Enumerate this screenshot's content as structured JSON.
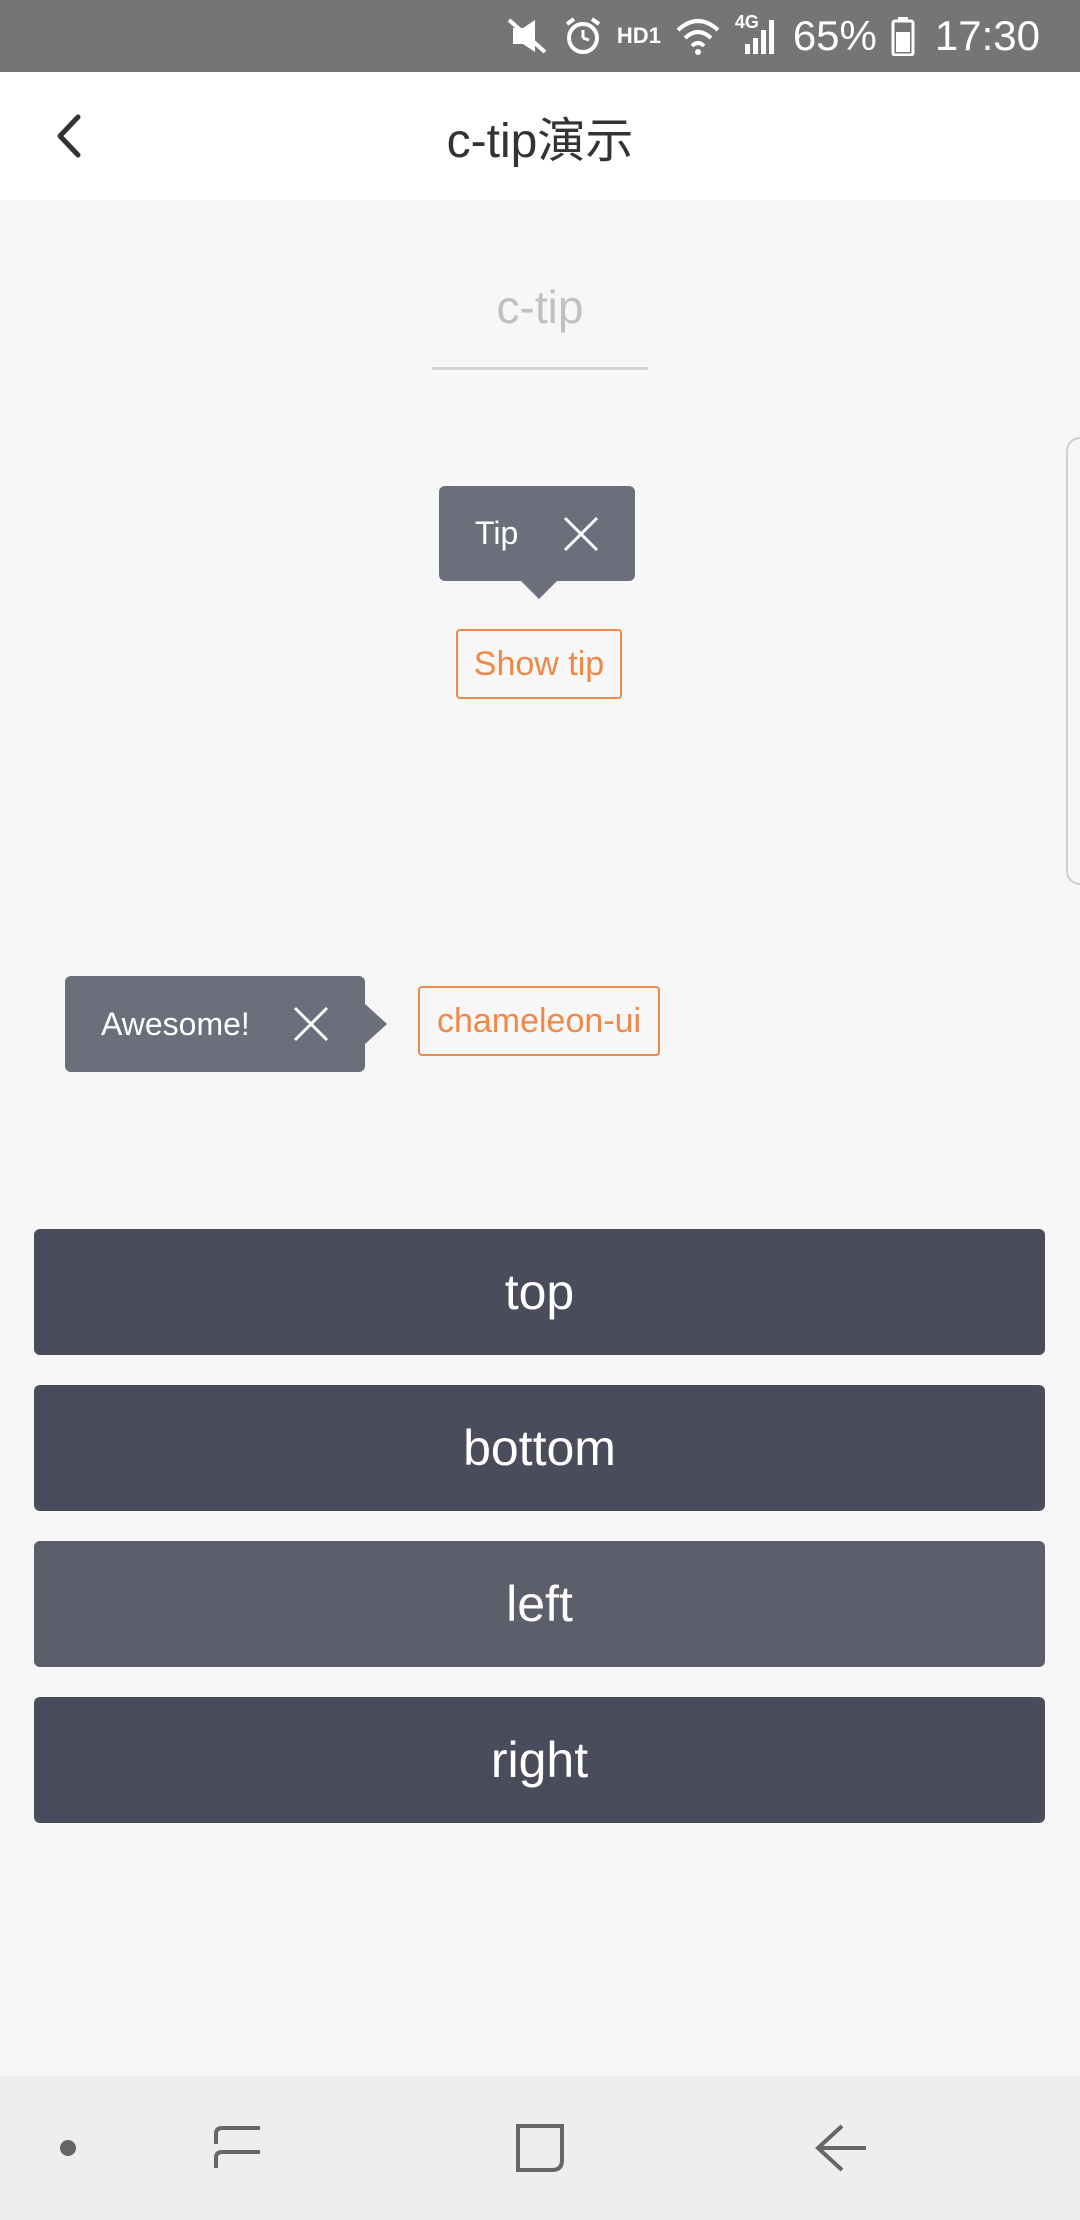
{
  "status_bar": {
    "icons": [
      "mute-vibrate-icon",
      "alarm-icon",
      "hd-icon",
      "wifi-icon",
      "signal-4g-icon",
      "battery-icon"
    ],
    "hd_label": "HD1",
    "network_label": "4G",
    "battery_percent": "65%",
    "time": "17:30"
  },
  "header": {
    "back_icon": "chevron-left-icon",
    "title": "c-tip演示"
  },
  "main": {
    "heading": "c-tip",
    "tip_top": {
      "text": "Tip",
      "close_icon": "close-icon"
    },
    "show_tip_button": "Show tip",
    "tip_left": {
      "text": "Awesome!",
      "close_icon": "close-icon"
    },
    "chameleon_button": "chameleon-ui",
    "direction_buttons": {
      "top": "top",
      "bottom": "bottom",
      "left": "left",
      "right": "right"
    }
  },
  "colors": {
    "accent": "#f0884a",
    "tip_background": "#6b6e7b",
    "button_background": "#4a4c5b",
    "button_pressed_background": "#5c5e6b",
    "page_background": "#f7f7f7"
  },
  "system_nav": {
    "icons": [
      "dot-icon",
      "recent-apps-icon",
      "home-icon",
      "back-arrow-icon"
    ]
  }
}
